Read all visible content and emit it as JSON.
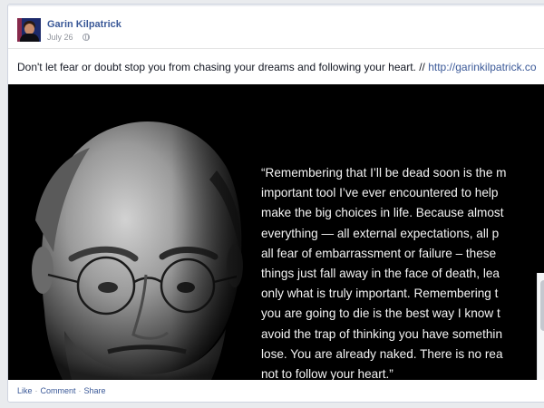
{
  "post": {
    "author": "Garin Kilpatrick",
    "date": "July 26",
    "privacy_icon": "globe-icon",
    "text": "Don't let fear or doubt stop you from chasing your dreams and following your heart. //",
    "link": "http://garinkilpatrick.co",
    "quote_lines": [
      "“Remembering that I’ll be dead soon is the m",
      "important tool I’ve ever encountered to help",
      "make the big choices in life. Because almost",
      "everything — all external expectations, all p",
      "all fear of embarrassment or failure – these",
      "things just fall away in the face of death, lea",
      "only what is truly important. Remembering t",
      "you are going to die is the best way I know t",
      "avoid the trap of thinking you have somethin",
      "lose. You are already naked. There is no rea",
      "not to follow your heart.”"
    ]
  },
  "actions": {
    "like": "Like",
    "comment": "Comment",
    "share": "Share",
    "separator": "·"
  },
  "colors": {
    "link_blue": "#3b5998",
    "meta_gray": "#90949c",
    "photo_bg": "#000000"
  }
}
